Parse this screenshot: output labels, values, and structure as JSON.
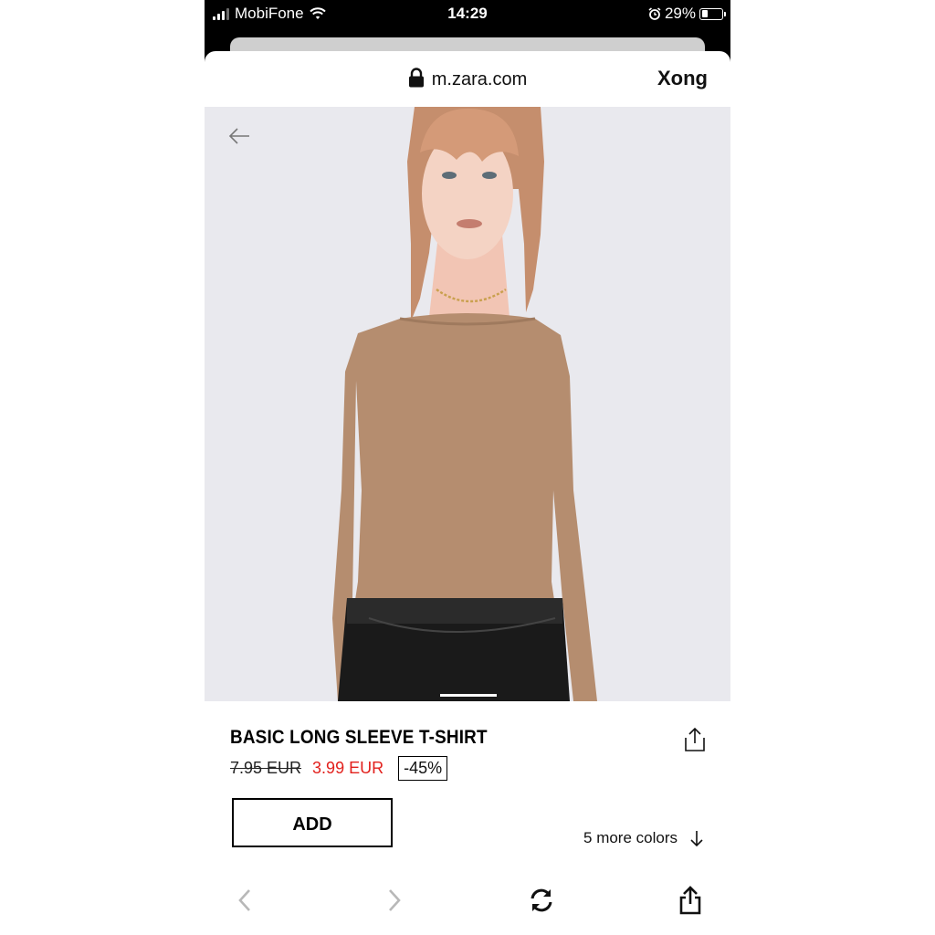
{
  "status_bar": {
    "carrier": "MobiFone",
    "time": "14:29",
    "battery_percent": "29%",
    "battery_level": 0.29,
    "icons": [
      "signal-icon",
      "wifi-icon",
      "alarm-icon",
      "battery-icon"
    ]
  },
  "browser": {
    "url": "m.zara.com",
    "done_label": "Xong",
    "icons": [
      "lock-icon",
      "chevron-left-icon",
      "chevron-right-icon",
      "refresh-icon",
      "share-icon"
    ]
  },
  "product": {
    "name": "BASIC LONG SLEEVE T-SHIRT",
    "old_price": "7.95 EUR",
    "new_price": "3.99 EUR",
    "discount": "-45%",
    "add_label": "ADD",
    "more_colors_label": "5 more colors"
  },
  "colors": {
    "sale_price": "#e2201c",
    "hero_background": "#e9e9ee",
    "top_colour": "#b58d6f",
    "skirt_colour": "#1a1a1a"
  }
}
